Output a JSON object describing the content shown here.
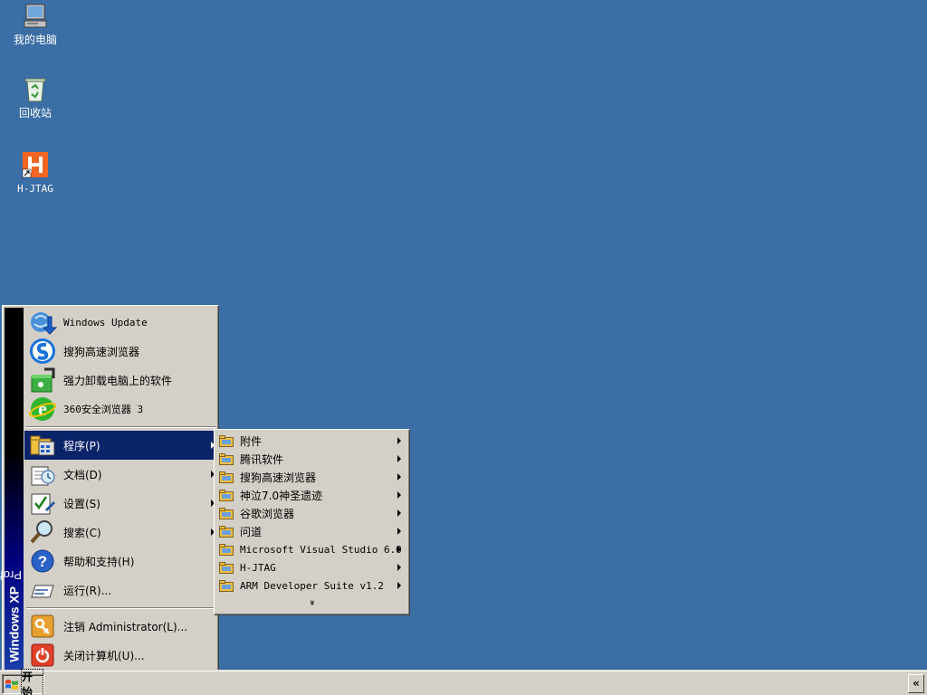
{
  "desktop": {
    "icons": [
      {
        "label": "我的电脑",
        "icon": "my-computer-icon"
      },
      {
        "label": "回收站",
        "icon": "recycle-bin-icon"
      },
      {
        "label": "H-JTAG",
        "icon": "h-jtag-icon"
      }
    ]
  },
  "start_menu": {
    "banner": {
      "brand": "Windows XP",
      "edition": "Professional"
    },
    "pinned": [
      {
        "label": "Windows Update",
        "icon": "windows-update-icon"
      },
      {
        "label": "搜狗高速浏览器",
        "icon": "sogou-browser-icon"
      },
      {
        "label": "强力卸载电脑上的软件",
        "icon": "uninstaller-icon"
      },
      {
        "label": "360安全浏览器 3",
        "icon": "360-browser-icon"
      }
    ],
    "items": [
      {
        "label": "程序(P)",
        "icon": "programs-icon",
        "submenu": true,
        "selected": true
      },
      {
        "label": "文档(D)",
        "icon": "documents-icon",
        "submenu": true
      },
      {
        "label": "设置(S)",
        "icon": "settings-icon",
        "submenu": true
      },
      {
        "label": "搜索(C)",
        "icon": "search-icon",
        "submenu": true
      },
      {
        "label": "帮助和支持(H)",
        "icon": "help-icon",
        "submenu": false
      },
      {
        "label": "运行(R)...",
        "icon": "run-icon",
        "submenu": false
      }
    ],
    "session": [
      {
        "label": "注销 Administrator(L)...",
        "icon": "logoff-icon"
      },
      {
        "label": "关闭计算机(U)...",
        "icon": "shutdown-icon"
      }
    ]
  },
  "programs_submenu": {
    "items": [
      {
        "label": "附件"
      },
      {
        "label": "腾讯软件"
      },
      {
        "label": "搜狗高速浏览器"
      },
      {
        "label": "神泣7.0神圣遗迹"
      },
      {
        "label": "谷歌浏览器"
      },
      {
        "label": "问道"
      },
      {
        "label": "Microsoft Visual Studio 6.0"
      },
      {
        "label": "H-JTAG"
      },
      {
        "label": "ARM Developer Suite v1.2"
      }
    ],
    "more_glyph": "»"
  },
  "taskbar": {
    "start_label": "开始",
    "tray_toggle": "«"
  },
  "colors": {
    "desktop": "#3a6ea5",
    "menu_face": "#d4d0c8",
    "highlight": "#0a246a"
  }
}
